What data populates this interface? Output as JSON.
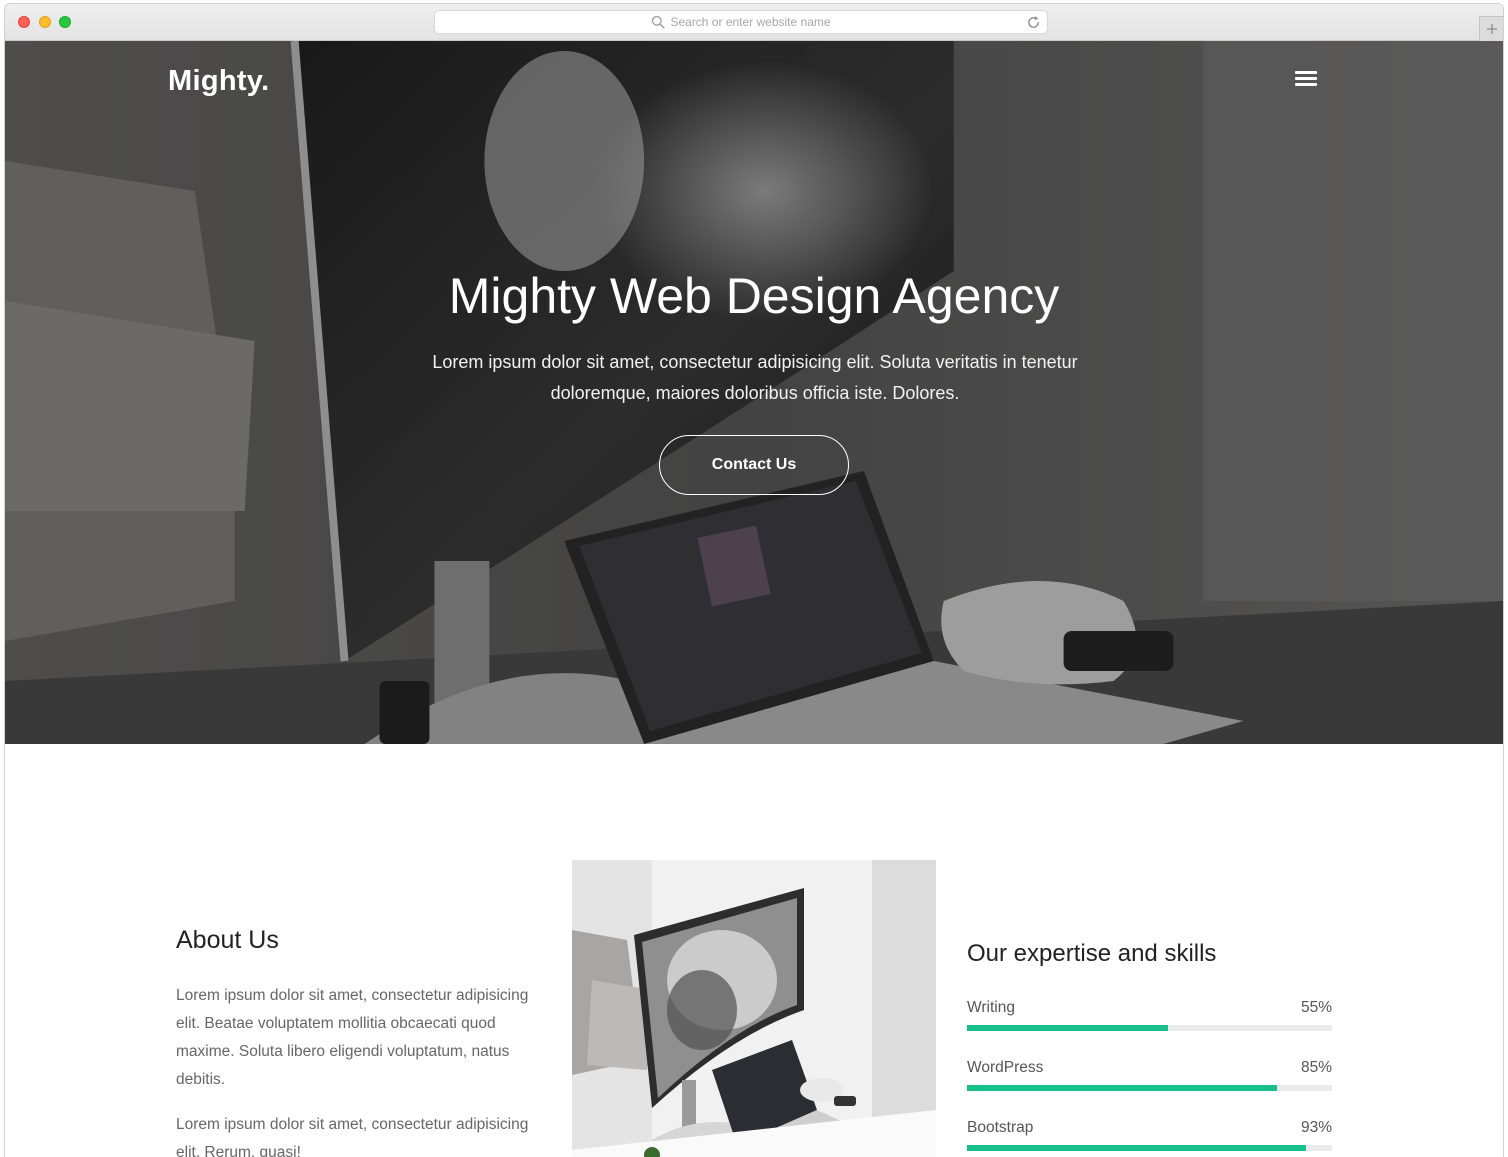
{
  "browser": {
    "address_placeholder": "Search or enter website name",
    "icons": [
      "search-icon",
      "reload-icon",
      "plus-icon"
    ]
  },
  "nav": {
    "logo": "Mighty.",
    "menu_icon": "hamburger-menu-icon"
  },
  "hero": {
    "title": "Mighty Web Design Agency",
    "text": "Lorem ipsum dolor sit amet, consectetur adipisicing elit. Soluta veritatis in tenetur doloremque, maiores doloribus officia iste. Dolores.",
    "cta_label": "Contact Us"
  },
  "about": {
    "heading": "About Us",
    "paragraphs": [
      "Lorem ipsum dolor sit amet, consectetur adipisicing elit. Beatae voluptatem mollitia obcaecati quod maxime. Soluta libero eligendi voluptatum, natus debitis.",
      "Lorem ipsum dolor sit amet, consectetur adipisicing elit. Rerum, quasi!"
    ]
  },
  "skills": {
    "heading": "Our expertise and skills",
    "accent_color": "#18c08a",
    "items": [
      {
        "label": "Writing",
        "percent_text": "55%",
        "value": 0.55
      },
      {
        "label": "WordPress",
        "percent_text": "85%",
        "value": 0.85
      },
      {
        "label": "Bootstrap",
        "percent_text": "93%",
        "value": 0.93
      }
    ]
  }
}
